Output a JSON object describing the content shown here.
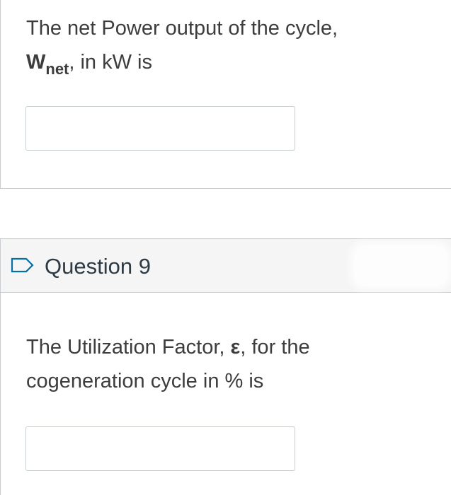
{
  "question8": {
    "text_line1": "The net Power output of the cycle,",
    "var_main": "W",
    "var_sub": "net",
    "text_line2_rest": ", in kW is",
    "answer_value": ""
  },
  "question9": {
    "title": "Question 9",
    "text_line1_part1": "The Utilization Factor, ",
    "symbol": "ε",
    "text_line1_part2": ", for the",
    "text_line2": "cogeneration cycle in % is",
    "answer_value": ""
  },
  "icons": {
    "flag": "flag-outline-icon"
  },
  "colors": {
    "text": "#3d3d3d",
    "border": "#c7cdd1",
    "header_bg": "#f5f5f5",
    "flag_stroke": "#0770a3"
  }
}
